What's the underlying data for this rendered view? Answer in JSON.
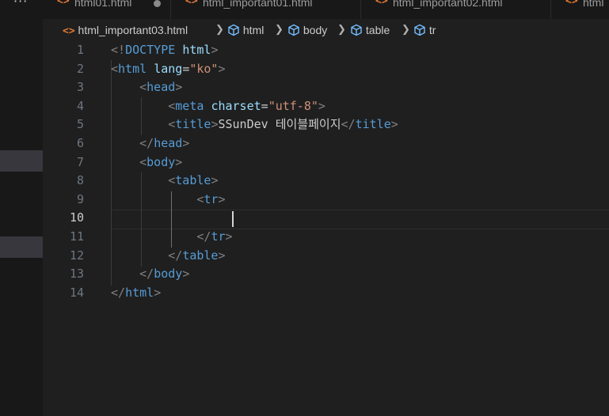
{
  "sidebar": {
    "more_label": "···"
  },
  "tabs": [
    {
      "icon": "<>",
      "label": "html01.html",
      "modified": true
    },
    {
      "icon": "<>",
      "label": "html_important01.html",
      "modified": false
    },
    {
      "icon": "<>",
      "label": "html_important02.html",
      "modified": false
    },
    {
      "icon": "<>",
      "label": "html",
      "modified": false
    }
  ],
  "breadcrumb": {
    "file": "html_important03.html",
    "items": [
      "html",
      "body",
      "table",
      "tr"
    ]
  },
  "editor": {
    "active_line": 10,
    "line_numbers": [
      "1",
      "2",
      "3",
      "4",
      "5",
      "6",
      "7",
      "8",
      "9",
      "10",
      "11",
      "12",
      "13",
      "14"
    ],
    "lines": [
      [
        {
          "t": "br",
          "v": "<!"
        },
        {
          "t": "tag",
          "v": "DOCTYPE"
        },
        {
          "t": "txt",
          "v": " "
        },
        {
          "t": "attr",
          "v": "html"
        },
        {
          "t": "br",
          "v": ">"
        }
      ],
      [
        {
          "t": "br",
          "v": "<"
        },
        {
          "t": "tag",
          "v": "html"
        },
        {
          "t": "txt",
          "v": " "
        },
        {
          "t": "attr",
          "v": "lang"
        },
        {
          "t": "eq",
          "v": "="
        },
        {
          "t": "str",
          "v": "\"ko\""
        },
        {
          "t": "br",
          "v": ">"
        }
      ],
      [
        {
          "t": "txt",
          "v": "    "
        },
        {
          "t": "br",
          "v": "<"
        },
        {
          "t": "tag",
          "v": "head"
        },
        {
          "t": "br",
          "v": ">"
        }
      ],
      [
        {
          "t": "txt",
          "v": "        "
        },
        {
          "t": "br",
          "v": "<"
        },
        {
          "t": "tag",
          "v": "meta"
        },
        {
          "t": "txt",
          "v": " "
        },
        {
          "t": "attr",
          "v": "charset"
        },
        {
          "t": "eq",
          "v": "="
        },
        {
          "t": "str",
          "v": "\"utf-8\""
        },
        {
          "t": "br",
          "v": ">"
        }
      ],
      [
        {
          "t": "txt",
          "v": "        "
        },
        {
          "t": "br",
          "v": "<"
        },
        {
          "t": "tag",
          "v": "title"
        },
        {
          "t": "br",
          "v": ">"
        },
        {
          "t": "txt",
          "v": "SSunDev 테이블페이지"
        },
        {
          "t": "br",
          "v": "</"
        },
        {
          "t": "tag",
          "v": "title"
        },
        {
          "t": "br",
          "v": ">"
        }
      ],
      [
        {
          "t": "txt",
          "v": "    "
        },
        {
          "t": "br",
          "v": "</"
        },
        {
          "t": "tag",
          "v": "head"
        },
        {
          "t": "br",
          "v": ">"
        }
      ],
      [
        {
          "t": "txt",
          "v": "    "
        },
        {
          "t": "br",
          "v": "<"
        },
        {
          "t": "tag",
          "v": "body"
        },
        {
          "t": "br",
          "v": ">"
        }
      ],
      [
        {
          "t": "txt",
          "v": "        "
        },
        {
          "t": "br",
          "v": "<"
        },
        {
          "t": "tag",
          "v": "table"
        },
        {
          "t": "br",
          "v": ">"
        }
      ],
      [
        {
          "t": "txt",
          "v": "            "
        },
        {
          "t": "br",
          "v": "<"
        },
        {
          "t": "tag",
          "v": "tr"
        },
        {
          "t": "br",
          "v": ">"
        }
      ],
      [
        {
          "t": "txt",
          "v": ""
        }
      ],
      [
        {
          "t": "txt",
          "v": "            "
        },
        {
          "t": "br",
          "v": "</"
        },
        {
          "t": "tag",
          "v": "tr"
        },
        {
          "t": "br",
          "v": ">"
        }
      ],
      [
        {
          "t": "txt",
          "v": "        "
        },
        {
          "t": "br",
          "v": "</"
        },
        {
          "t": "tag",
          "v": "table"
        },
        {
          "t": "br",
          "v": ">"
        }
      ],
      [
        {
          "t": "txt",
          "v": "    "
        },
        {
          "t": "br",
          "v": "</"
        },
        {
          "t": "tag",
          "v": "body"
        },
        {
          "t": "br",
          "v": ">"
        }
      ],
      [
        {
          "t": "br",
          "v": "</"
        },
        {
          "t": "tag",
          "v": "html"
        },
        {
          "t": "br",
          "v": ">"
        }
      ]
    ]
  }
}
